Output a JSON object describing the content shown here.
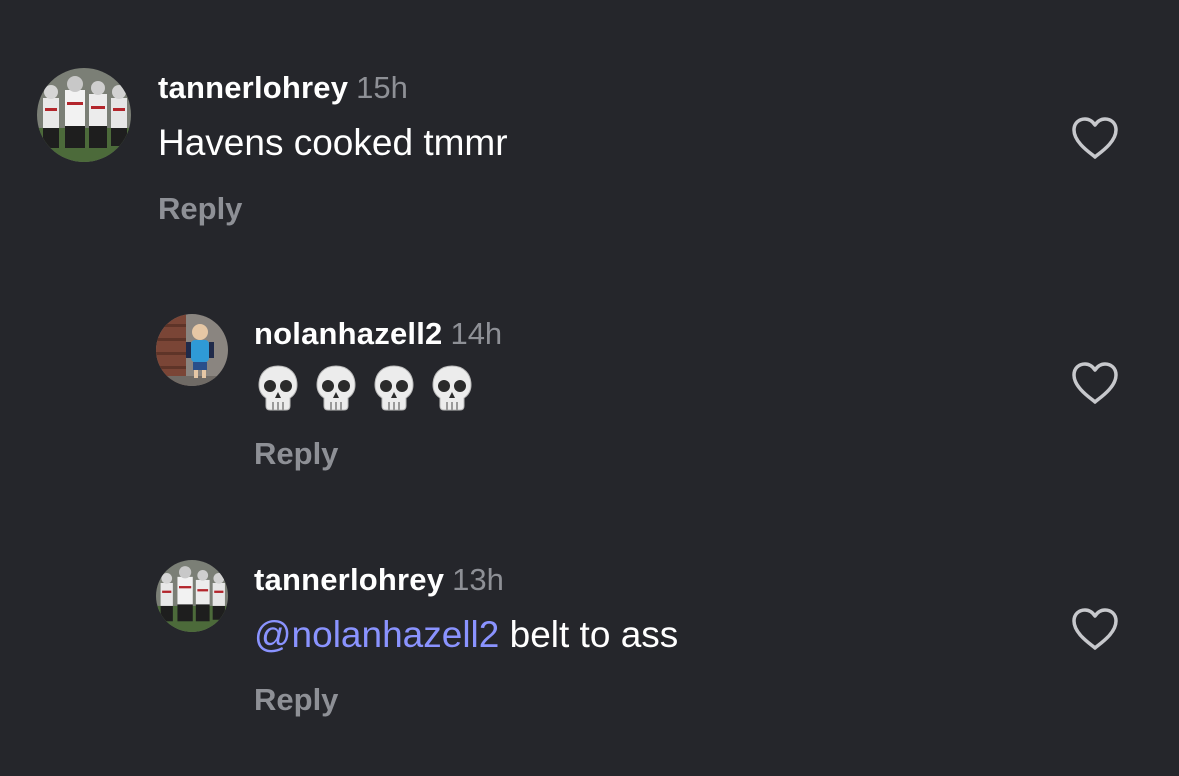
{
  "comments": [
    {
      "username": "tannerlohrey",
      "time": "15h",
      "text": "Havens cooked tmmr",
      "reply_label": "Reply",
      "avatar": "football-team-photo",
      "like_icon": "heart-outline-icon"
    },
    {
      "username": "nolanhazell2",
      "time": "14h",
      "text_emoji": "💀💀💀💀",
      "emoji_icon": "skull-icon",
      "reply_label": "Reply",
      "avatar": "child-in-blue-shirt-photo",
      "like_icon": "heart-outline-icon"
    },
    {
      "username": "tannerlohrey",
      "time": "13h",
      "mention": "@nolanhazell2",
      "text": " belt to ass",
      "reply_label": "Reply",
      "avatar": "football-team-photo",
      "like_icon": "heart-outline-icon"
    }
  ],
  "colors": {
    "background": "#25262b",
    "username": "#ffffff",
    "timestamp": "#8e9096",
    "mention": "#8a93ff",
    "heart_stroke": "#c7c8cc"
  }
}
